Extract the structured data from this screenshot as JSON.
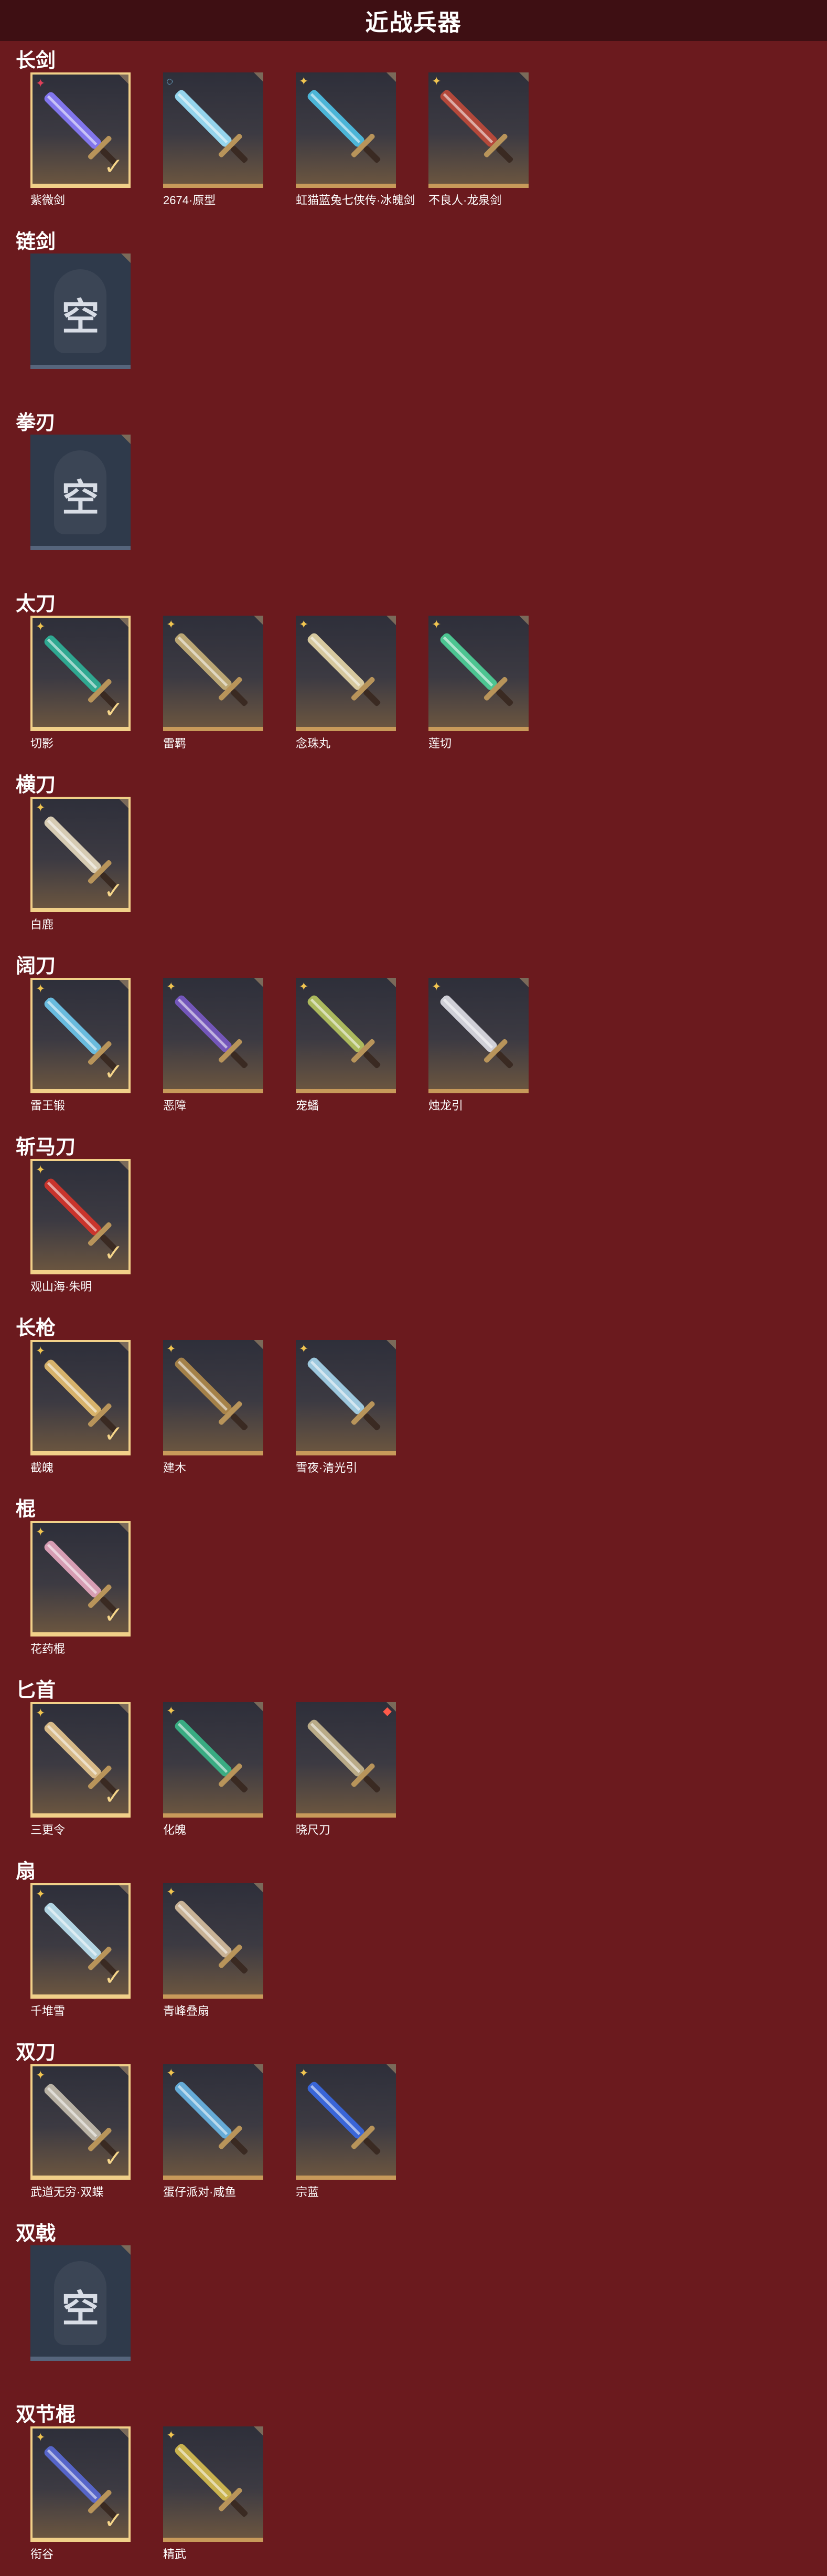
{
  "page": {
    "title": "近战兵器"
  },
  "empty_label": "空",
  "categories": [
    {
      "name": "长剑",
      "items": [
        {
          "name": "紫微剑",
          "rarity": "red-star-icon",
          "equipped": true,
          "color": "#8a7cff"
        },
        {
          "name": "2674·原型",
          "rarity": "rainbow-ring-icon",
          "equipped": false,
          "color": "#9fe6ff"
        },
        {
          "name": "虹猫蓝兔七侠传·冰魄剑",
          "rarity": "gold-star-icon",
          "equipped": false,
          "color": "#4fc3e8"
        },
        {
          "name": "不良人·龙泉剑",
          "rarity": "gold-star-icon",
          "equipped": false,
          "color": "#c24a3a"
        }
      ]
    },
    {
      "name": "链剑",
      "items": []
    },
    {
      "name": "拳刃",
      "items": []
    },
    {
      "name": "太刀",
      "items": [
        {
          "name": "切影",
          "rarity": "gold-star-icon",
          "equipped": true,
          "color": "#2fb59a"
        },
        {
          "name": "雷羁",
          "rarity": "gold-star-icon",
          "equipped": false,
          "color": "#c9b27a"
        },
        {
          "name": "念珠丸",
          "rarity": "gold-star-icon",
          "equipped": false,
          "color": "#e8d8a8"
        },
        {
          "name": "莲切",
          "rarity": "gold-star-icon",
          "equipped": false,
          "color": "#4fd49a"
        }
      ]
    },
    {
      "name": "横刀",
      "items": [
        {
          "name": "白鹿",
          "rarity": "gold-star-icon",
          "equipped": true,
          "color": "#e8dcc0"
        }
      ]
    },
    {
      "name": "阔刀",
      "items": [
        {
          "name": "雷王锻",
          "rarity": "gold-star-icon",
          "equipped": true,
          "color": "#6fcaf0"
        },
        {
          "name": "恶障",
          "rarity": "gold-star-icon",
          "equipped": false,
          "color": "#7a5ac8"
        },
        {
          "name": "宠蟠",
          "rarity": "gold-star-icon",
          "equipped": false,
          "color": "#b8c860"
        },
        {
          "name": "烛龙引",
          "rarity": "gold-star-icon",
          "equipped": false,
          "color": "#e0e0e8"
        }
      ]
    },
    {
      "name": "斩马刀",
      "items": [
        {
          "name": "观山海·朱明",
          "rarity": "gold-star-icon",
          "equipped": true,
          "color": "#d8342a"
        }
      ]
    },
    {
      "name": "长枪",
      "items": [
        {
          "name": "截魄",
          "rarity": "gold-star-icon",
          "equipped": true,
          "color": "#e8c070"
        },
        {
          "name": "建木",
          "rarity": "gold-star-icon",
          "equipped": false,
          "color": "#b08a4a"
        },
        {
          "name": "雪夜·清光引",
          "rarity": "gold-star-icon",
          "equipped": false,
          "color": "#a8d8f0"
        }
      ]
    },
    {
      "name": "棍",
      "items": [
        {
          "name": "花药棍",
          "rarity": "gold-star-icon",
          "equipped": true,
          "color": "#e8a8c0"
        }
      ]
    },
    {
      "name": "匕首",
      "items": [
        {
          "name": "三更令",
          "rarity": "gold-star-icon",
          "equipped": true,
          "color": "#e8c890"
        },
        {
          "name": "化魄",
          "rarity": "gold-star-icon",
          "equipped": false,
          "color": "#3ab88a"
        },
        {
          "name": "晓尺刀",
          "rarity": "red-diamond-icon",
          "equipped": false,
          "color": "#c8b890"
        }
      ]
    },
    {
      "name": "扇",
      "items": [
        {
          "name": "千堆雪",
          "rarity": "gold-star-icon",
          "equipped": true,
          "color": "#bfe6f4"
        },
        {
          "name": "青峰叠扇",
          "rarity": "gold-star-icon",
          "equipped": false,
          "color": "#d8c0a0"
        }
      ]
    },
    {
      "name": "双刀",
      "items": [
        {
          "name": "武道无穷·双蝶",
          "rarity": "gold-star-icon",
          "equipped": true,
          "color": "#c8c0b0"
        },
        {
          "name": "蛋仔派对·咸鱼",
          "rarity": "gold-star-icon",
          "equipped": false,
          "color": "#6ab8e8"
        },
        {
          "name": "宗蓝",
          "rarity": "gold-star-icon",
          "equipped": false,
          "color": "#3a6ae8"
        }
      ]
    },
    {
      "name": "双戟",
      "items": []
    },
    {
      "name": "双节棍",
      "items": [
        {
          "name": "衔谷",
          "rarity": "gold-star-icon",
          "equipped": true,
          "color": "#5a6ad8"
        },
        {
          "name": "精武",
          "rarity": "gold-star-icon",
          "equipped": false,
          "color": "#d8c050"
        }
      ]
    }
  ]
}
